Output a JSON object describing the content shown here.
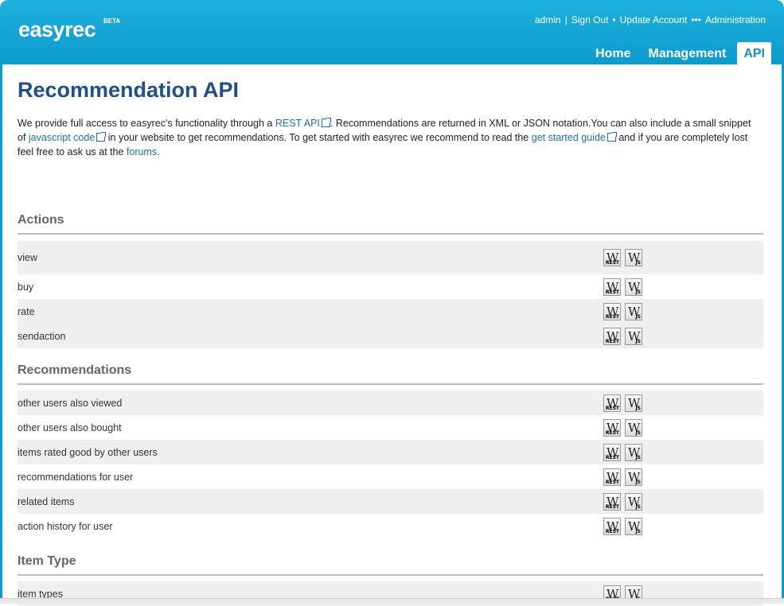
{
  "header": {
    "logo": "easyrec",
    "beta": "BETA",
    "user_links": [
      "admin",
      "Sign Out",
      "Update Account",
      "Administration"
    ],
    "nav": [
      "Home",
      "Management",
      "API"
    ],
    "active_nav": "API"
  },
  "page": {
    "title": "Recommendation API",
    "intro": {
      "p1": "We provide full access to easyrec's functionality through a ",
      "link_rest": "REST API",
      "p2": ". Recommendations are returned in XML or JSON notation.You can also include a small snippet of ",
      "link_js": "javascript code",
      "p3": " in your website to get recommendations. To get started with easyrec we recommend to read the ",
      "link_guide": "get started guide",
      "p4": " and if you are completely lost feel free to ask us at the ",
      "link_forums": "forums",
      "p5": "."
    }
  },
  "icons": {
    "rest_sub": "REST",
    "js_sub": "JS",
    "glyph": "W"
  },
  "sections": [
    {
      "title": "Actions",
      "items": [
        "view",
        "buy",
        "rate",
        "sendaction"
      ]
    },
    {
      "title": "Recommendations",
      "items": [
        "other users also viewed",
        "other users also bought",
        "items rated good by other users",
        "recommendations for user",
        "related items",
        "action history for user"
      ]
    },
    {
      "title": "Item Type",
      "items": [
        "item types"
      ]
    }
  ],
  "colors": {
    "header": "#0d9bcc",
    "title": "#1f4e8a",
    "link": "#1a6fb5",
    "row_shade": "#efefef"
  }
}
